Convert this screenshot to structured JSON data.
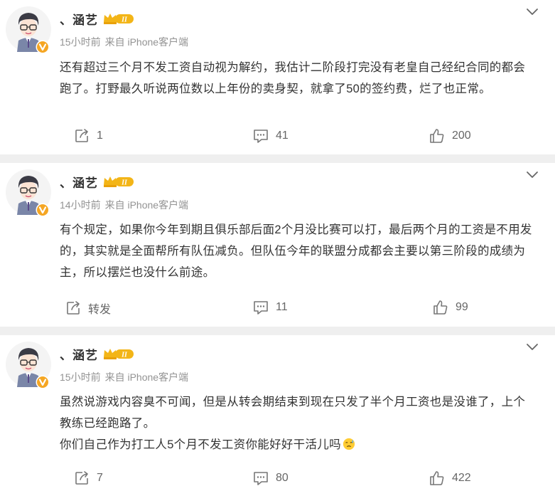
{
  "posts": [
    {
      "author": "、涵艺",
      "time": "15小时前",
      "source": "来自 iPhone客户端",
      "paragraphs": [
        "还有超过三个月不发工资自动视为解约，我估计二阶段打完没有老皇自己经纪合同的都会跑了。打野最久听说两位数以上年份的卖身契，就拿了50的签约费，烂了也正常。"
      ],
      "repost": "1",
      "comments": "41",
      "likes": "200"
    },
    {
      "author": "、涵艺",
      "time": "14小时前",
      "source": "来自 iPhone客户端",
      "paragraphs": [
        "有个规定，如果你今年到期且俱乐部后面2个月没比赛可以打，最后两个月的工资是不用发的，其实就是全面帮所有队伍减负。但队伍今年的联盟分成都会主要以第三阶段的成绩为主，所以摆烂也没什么前途。"
      ],
      "repost": "转发",
      "comments": "11",
      "likes": "99"
    },
    {
      "author": "、涵艺",
      "time": "15小时前",
      "source": "来自 iPhone客户端",
      "paragraphs": [
        "虽然说游戏内容臭不可闻，但是从转会期结束到现在只发了半个月工资也是没谁了，上个教练已经跑路了。",
        "你们自己作为打工人5个月不发工资你能好好干活儿吗"
      ],
      "repost": "7",
      "comments": "80",
      "likes": "422"
    }
  ],
  "icons": {
    "more": "chevron-down-icon",
    "repost": "repost-icon",
    "comment": "comment-icon",
    "like": "thumbs-up-icon",
    "verified": "verified-badge-icon",
    "member": "member-crown-icon",
    "emoji": "sweat-emoji-icon"
  },
  "colors": {
    "verified": "#f5a623",
    "crown": "#f3b517",
    "meta": "#939393",
    "text": "#333333",
    "background": "#efefef"
  }
}
